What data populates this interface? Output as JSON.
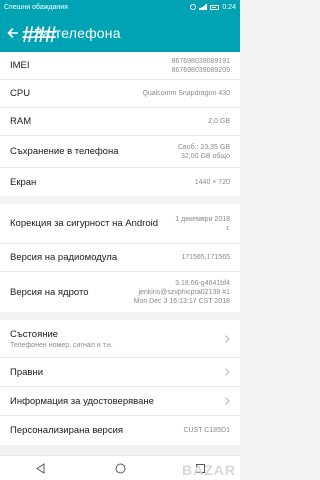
{
  "statusbar": {
    "left": "Спешни обаждания",
    "time": "0:24"
  },
  "appbar": {
    "title": "За телефона",
    "watermark": "###"
  },
  "section1": {
    "imei": {
      "label": "IMEI",
      "value1": "867698039089191",
      "value2": "867698039089209"
    },
    "cpu": {
      "label": "CPU",
      "value": "Qualcomm Snapdragon 430"
    },
    "ram": {
      "label": "RAM",
      "value": "2,0 GB"
    },
    "storage": {
      "label": "Съхранение в телефона",
      "value1": "Своб.: 23,35  GB",
      "value2": "32,00  GB общо"
    },
    "screen": {
      "label": "Екран",
      "value": "1440 × 720"
    }
  },
  "section2": {
    "security": {
      "label1": "Корекция за сигурност на",
      "label2": "Android",
      "value1": "1 декември 2018",
      "value2": "г."
    },
    "radio": {
      "label": "Версия на радиомодула",
      "value": "171565,171565"
    },
    "kernel": {
      "label": "Версия на ядрото",
      "value1": "3.18.66-g4641bf4",
      "value2": "jenkins@szvphicpra02139 #1",
      "value3": "Mon Dec 3 16:13:17 CST 2018"
    }
  },
  "section3": {
    "status": {
      "label": "Състояние",
      "sub": "Телефонен номер, сигнал и т.н."
    },
    "legal": {
      "label": "Правни"
    },
    "certification": {
      "label": "Информация за удостоверяване"
    },
    "custom": {
      "label": "Персонализирана версия",
      "value": "CUST C185D1"
    }
  },
  "navbar": {
    "logo": "BAZAR"
  },
  "colors": {
    "accent": "#00a3b3"
  }
}
